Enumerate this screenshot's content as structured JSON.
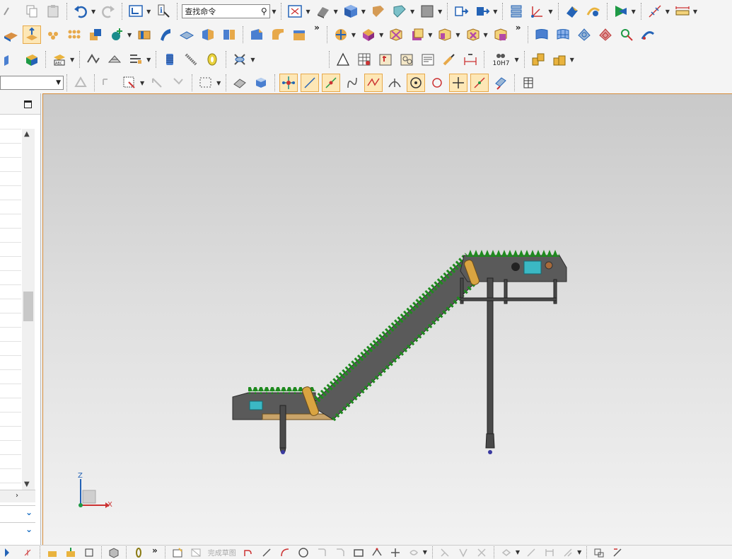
{
  "toolbar": {
    "search_placeholder": "查找命令",
    "search_value": "查找命令",
    "more_label": "»",
    "tolerance_label": "10H7"
  },
  "status": {
    "finish_sketch_label": "完成草图"
  },
  "axes": {
    "z_label": "Z",
    "x_label": "X"
  },
  "left_panel": {
    "row_count": 27
  },
  "colors": {
    "accent_orange": "#d68c3a",
    "belt_green": "#1f8a1f",
    "frame_gray": "#5a5a5a",
    "highlight": "#fde7b6"
  },
  "icons": [
    "undo-icon",
    "redo-icon",
    "copy-icon",
    "paste-icon",
    "search-icon",
    "view-fit-icon",
    "cube-icon",
    "shaded-icon",
    "sketch-icon",
    "extrude-icon",
    "revolve-icon",
    "hole-icon",
    "fillet-icon",
    "chamfer-icon",
    "shell-icon",
    "pattern-icon",
    "mirror-icon",
    "section-icon",
    "measure-icon",
    "dimension-icon",
    "line-icon",
    "arc-icon",
    "circle-icon",
    "rectangle-icon",
    "point-icon",
    "trim-icon",
    "coordinate-system-icon"
  ]
}
